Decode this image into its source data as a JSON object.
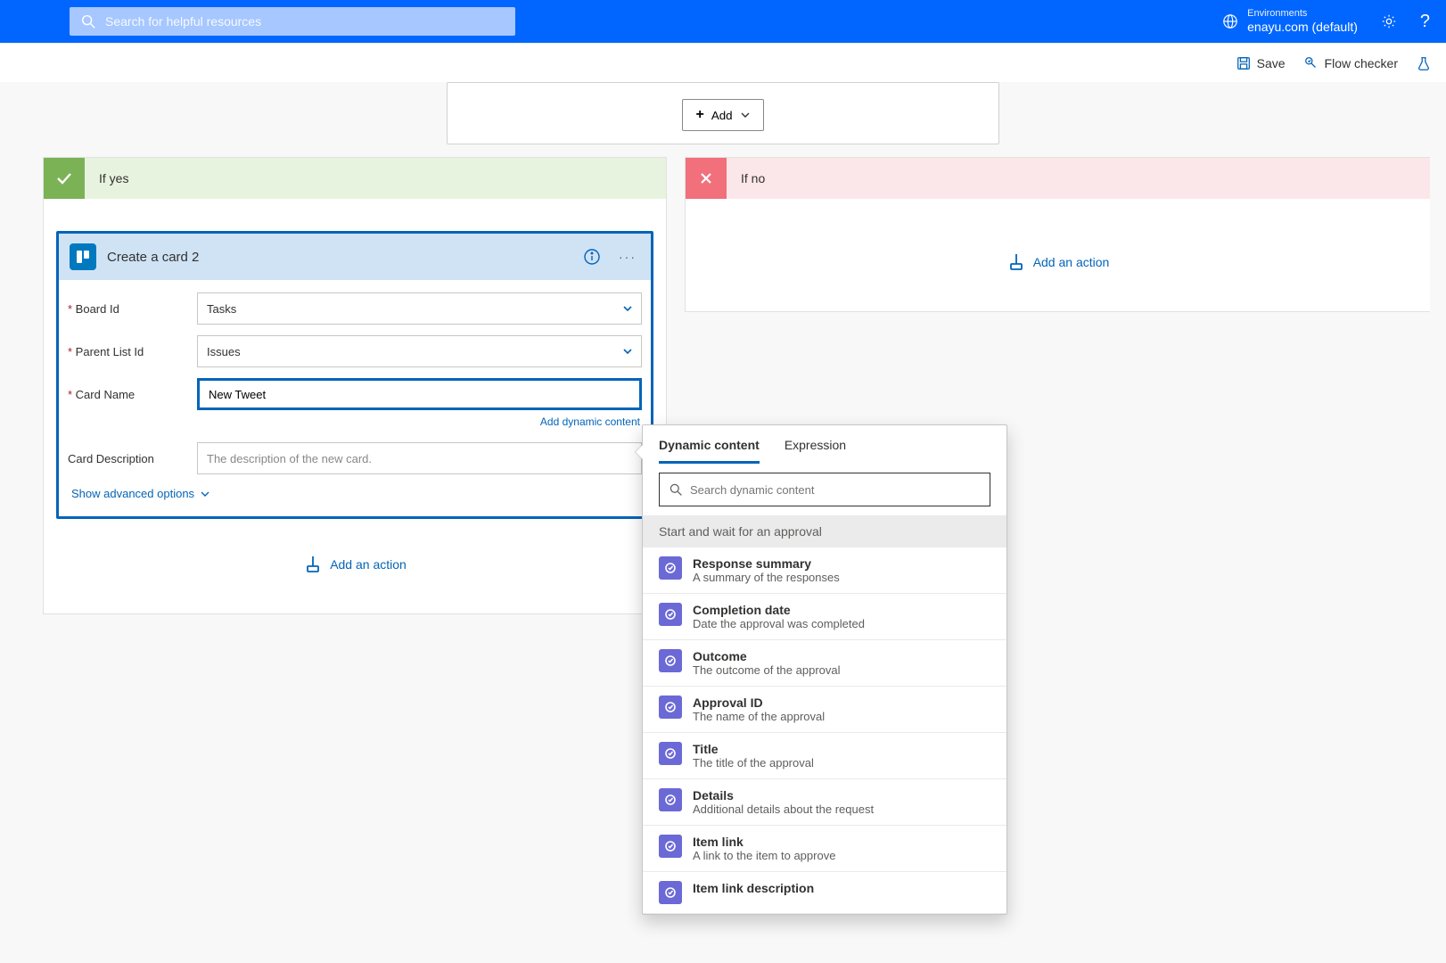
{
  "topbar": {
    "search_placeholder": "Search for helpful resources",
    "env_label": "Environments",
    "env_value": "enayu.com (default)"
  },
  "cmdbar": {
    "save": "Save",
    "flow_checker": "Flow checker"
  },
  "condition": {
    "add_label": "Add"
  },
  "branches": {
    "yes_title": "If yes",
    "no_title": "If no",
    "add_action": "Add an action",
    "add_action_truncated": "Add an a"
  },
  "action": {
    "title": "Create a card 2",
    "fields": {
      "board_id_label": "Board Id",
      "board_id_value": "Tasks",
      "parent_list_label": "Parent List Id",
      "parent_list_value": "Issues",
      "card_name_label": "Card Name",
      "card_name_value": "New Tweet",
      "card_desc_label": "Card Description",
      "card_desc_placeholder": "The description of the new card."
    },
    "dyn_link": "Add dynamic content",
    "adv_link": "Show advanced options"
  },
  "popover": {
    "tab_dynamic": "Dynamic content",
    "tab_expression": "Expression",
    "search_placeholder": "Search dynamic content",
    "group": "Start and wait for an approval",
    "items": [
      {
        "t": "Response summary",
        "d": "A summary of the responses"
      },
      {
        "t": "Completion date",
        "d": "Date the approval was completed"
      },
      {
        "t": "Outcome",
        "d": "The outcome of the approval"
      },
      {
        "t": "Approval ID",
        "d": "The name of the approval"
      },
      {
        "t": "Title",
        "d": "The title of the approval"
      },
      {
        "t": "Details",
        "d": "Additional details about the request"
      },
      {
        "t": "Item link",
        "d": "A link to the item to approve"
      },
      {
        "t": "Item link description",
        "d": ""
      }
    ]
  }
}
